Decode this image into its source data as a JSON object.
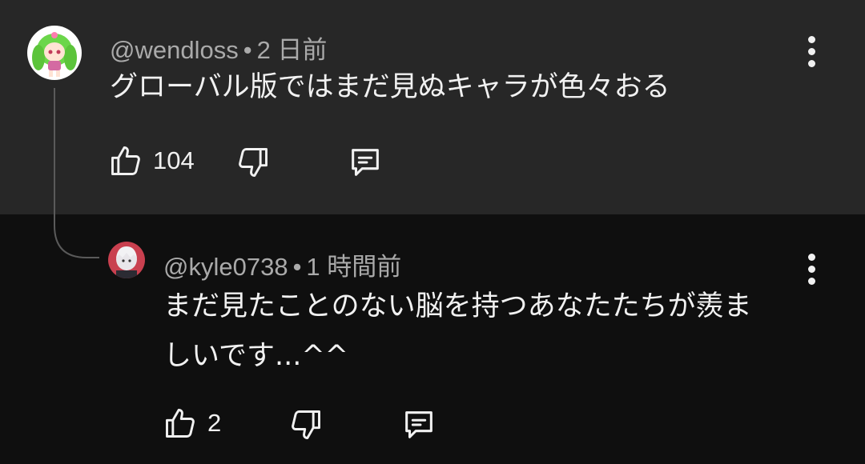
{
  "comment": {
    "author": "@wendloss",
    "separator": "•",
    "time": "2 日前",
    "text": "グローバル版ではまだ見ぬキャラが色々おる",
    "likes": "104",
    "icons": {
      "like": "thumbs-up-icon",
      "dislike": "thumbs-down-icon",
      "reply": "comment-icon",
      "more": "more-vert-icon"
    }
  },
  "reply": {
    "author": "@kyle0738",
    "separator": "•",
    "time": "1 時間前",
    "text_line1": "まだ見たことのない脳を持つあなたたちが羨ま",
    "text_line2": "しいです...^^",
    "likes": "2"
  },
  "colors": {
    "top_bg": "#272727",
    "bottom_bg": "#0f0f0f",
    "text": "#f1f1f1",
    "meta": "#aaaaaa"
  }
}
